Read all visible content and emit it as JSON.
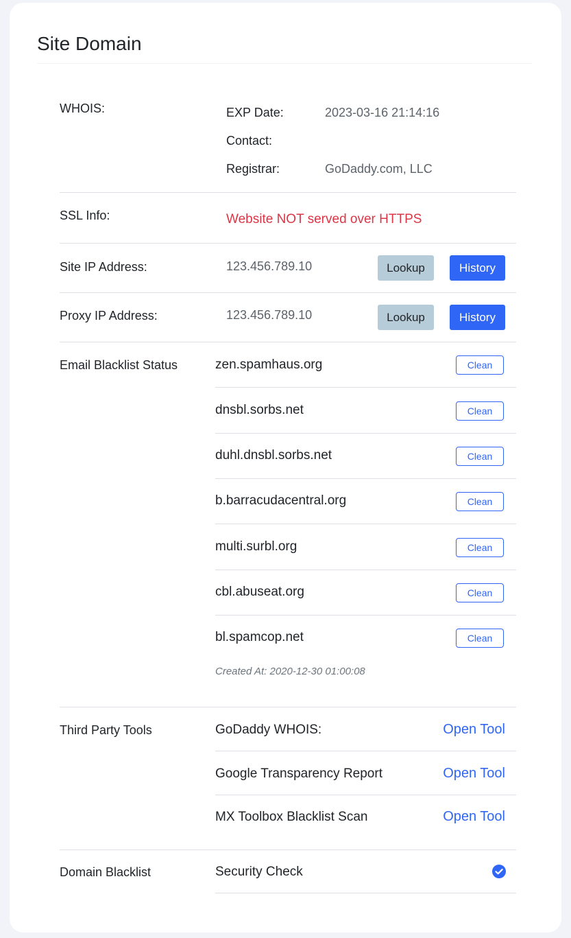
{
  "card": {
    "title": "Site Domain"
  },
  "whois": {
    "label": "WHOIS:",
    "exp_label": "EXP Date:",
    "exp_value": "2023-03-16 21:14:16",
    "contact_label": "Contact:",
    "contact_value": "",
    "registrar_label": "Registrar:",
    "registrar_value": "GoDaddy.com, LLC"
  },
  "ssl": {
    "label": "SSL Info:",
    "status": "Website NOT served over HTTPS",
    "status_color": "#dc3545"
  },
  "site_ip": {
    "label": "Site IP Address:",
    "value": "123.456.789.10",
    "lookup_label": "Lookup",
    "history_label": "History"
  },
  "proxy_ip": {
    "label": "Proxy IP Address:",
    "value": "123.456.789.10",
    "lookup_label": "Lookup",
    "history_label": "History"
  },
  "blacklist": {
    "label": "Email Blacklist Status",
    "items": [
      {
        "name": "zen.spamhaus.org",
        "status": "Clean"
      },
      {
        "name": "dnsbl.sorbs.net",
        "status": "Clean"
      },
      {
        "name": "duhl.dnsbl.sorbs.net",
        "status": "Clean"
      },
      {
        "name": "b.barracudacentral.org",
        "status": "Clean"
      },
      {
        "name": "multi.surbl.org",
        "status": "Clean"
      },
      {
        "name": "cbl.abuseat.org",
        "status": "Clean"
      },
      {
        "name": "bl.spamcop.net",
        "status": "Clean"
      }
    ],
    "created_at": "Created At: 2020-12-30 01:00:08"
  },
  "tools": {
    "label": "Third Party Tools",
    "items": [
      {
        "name": "GoDaddy WHOIS:",
        "link": "Open Tool"
      },
      {
        "name": "Google Transparency Report",
        "link": "Open Tool"
      },
      {
        "name": "MX Toolbox Blacklist Scan",
        "link": "Open Tool"
      }
    ]
  },
  "domain_blacklist": {
    "label": "Domain Blacklist",
    "check_label": "Security Check",
    "check_icon": "check-circle-icon"
  },
  "colors": {
    "accent": "#2f66f6",
    "danger": "#dc3545",
    "lookup_bg": "#b6ccd8",
    "page_bg": "#f1f3f9"
  }
}
